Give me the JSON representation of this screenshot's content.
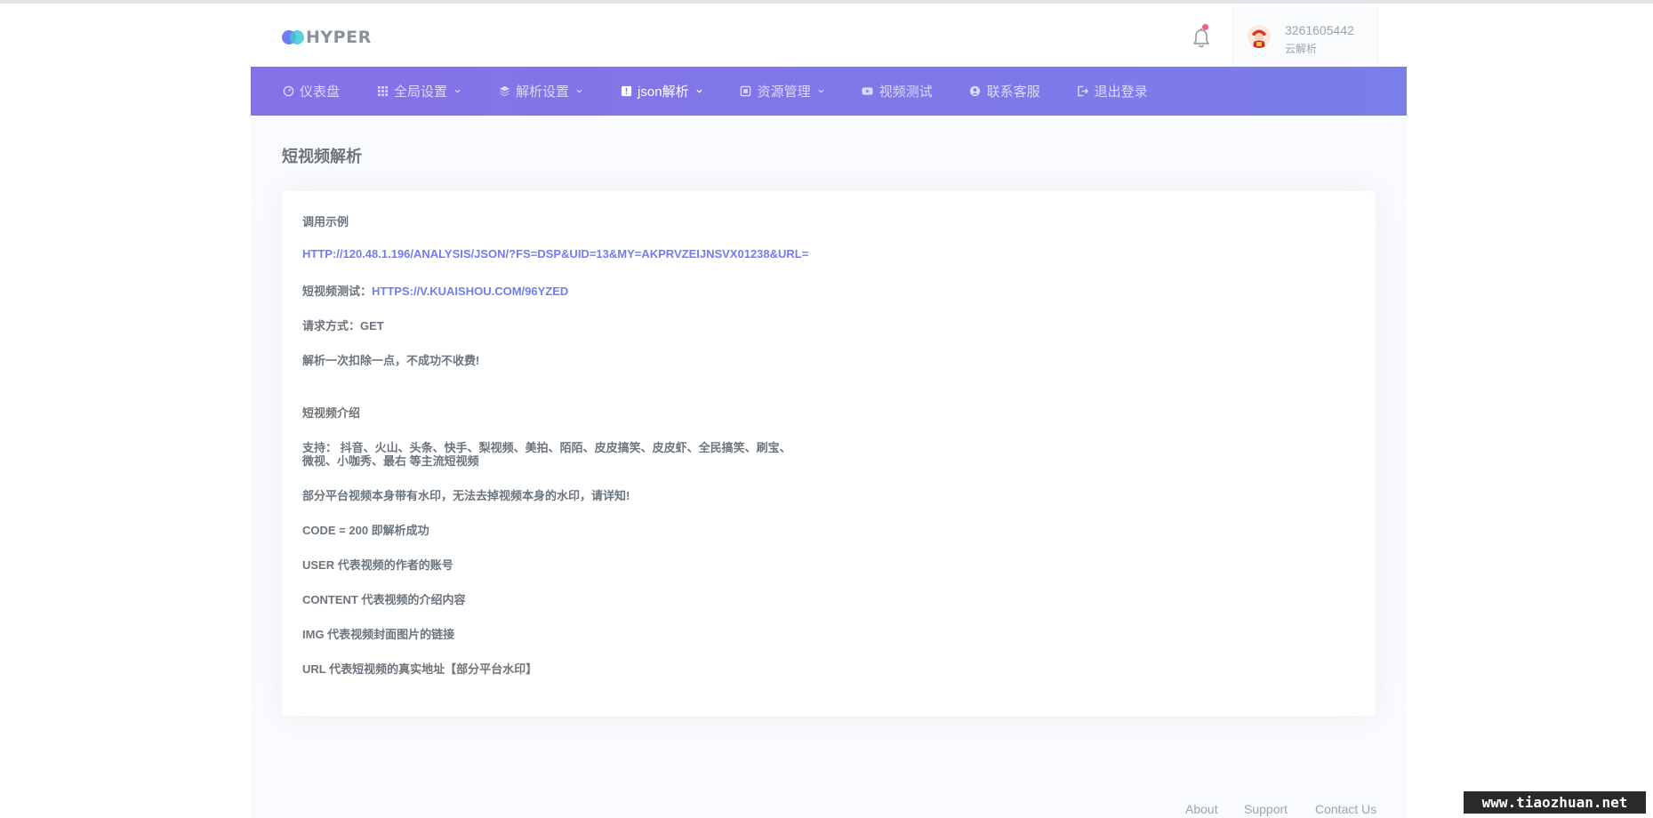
{
  "brand": {
    "name": "HYPER"
  },
  "user": {
    "id": "3261605442",
    "role": "云解析"
  },
  "nav": {
    "items": [
      {
        "label": "仪表盘",
        "icon": "dashboard-icon",
        "dropdown": false,
        "active": false
      },
      {
        "label": "全局设置",
        "icon": "grid-icon",
        "dropdown": true,
        "active": false
      },
      {
        "label": "解析设置",
        "icon": "layers-icon",
        "dropdown": true,
        "active": false
      },
      {
        "label": "json解析",
        "icon": "info-icon",
        "dropdown": true,
        "active": true
      },
      {
        "label": "资源管理",
        "icon": "box-icon",
        "dropdown": true,
        "active": false
      },
      {
        "label": "视频测试",
        "icon": "youtube-icon",
        "dropdown": false,
        "active": false
      },
      {
        "label": "联系客服",
        "icon": "user-circle-icon",
        "dropdown": false,
        "active": false
      },
      {
        "label": "退出登录",
        "icon": "logout-icon",
        "dropdown": false,
        "active": false
      }
    ]
  },
  "page": {
    "title": "短视频解析"
  },
  "content": {
    "example_heading": "调用示例",
    "api_url": "HTTP://120.48.1.196/ANALYSIS/JSON/?FS=DSP&UID=13&MY=AKPRVZEIJNSVX01238&URL=",
    "test_label": "短视频测试：",
    "test_url": "HTTPS://V.KUAISHOU.COM/96YZED",
    "method": "请求方式：GET",
    "fee_note": "解析一次扣除一点，不成功不收费!",
    "intro_heading": "短视频介绍",
    "support_line1": "支持： 抖音、火山、头条、快手、梨视频、美拍、陌陌、皮皮搞笑、皮皮虾、全民搞笑、刷宝、",
    "support_line2": "微视、小咖秀、最右 等主流短视频",
    "watermark_note": "部分平台视频本身带有水印，无法去掉视频本身的水印，请详知!",
    "code_note": "CODE = 200 即解析成功",
    "user_note": "USER 代表视频的作者的账号",
    "content_note": "CONTENT 代表视频的介绍内容",
    "img_note": "IMG 代表视频封面图片的链接",
    "url_note": "URL 代表短视频的真实地址【部分平台水印】"
  },
  "footer": {
    "about": "About",
    "support": "Support",
    "contact": "Contact Us"
  },
  "watermark": "www.tiaozhuan.net",
  "colors": {
    "nav_start": "#8571e8",
    "nav_end": "#7b7de9",
    "link": "#727cf5",
    "text": "#6c757d"
  }
}
